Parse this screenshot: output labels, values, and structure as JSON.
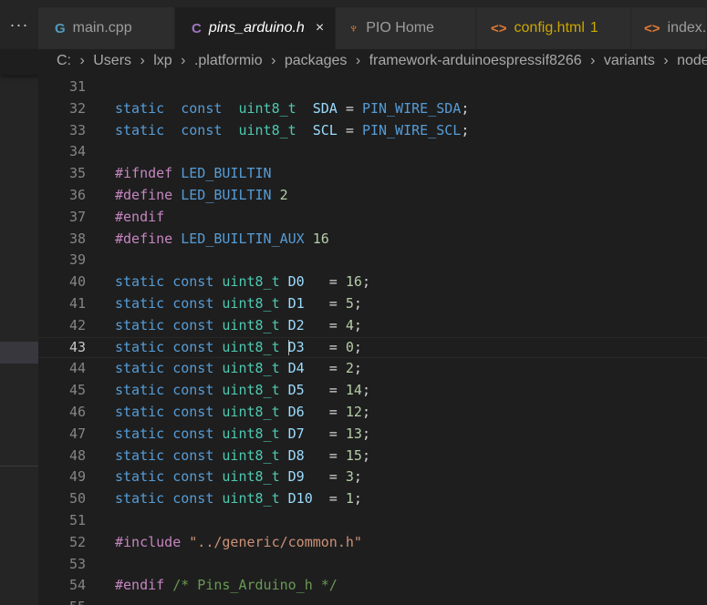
{
  "tabs": [
    {
      "label": "main.cpp",
      "icon": "c-plus-plus-file-icon",
      "glyph": "G",
      "active": false
    },
    {
      "label": "pins_arduino.h",
      "icon": "c-header-file-icon",
      "glyph": "C",
      "active": true,
      "close": "×"
    },
    {
      "label": "PIO Home",
      "icon": "platformio-ant-icon",
      "glyph": "♆",
      "active": false
    },
    {
      "label": "config.html",
      "icon": "html-file-icon",
      "glyph": "<>",
      "badge": "1",
      "active": false
    },
    {
      "label": "index.h",
      "icon": "html-file-icon",
      "glyph": "<>",
      "active": false
    }
  ],
  "more_tabs": "···",
  "breadcrumb": [
    "C:",
    "Users",
    "lxp",
    ".platformio",
    "packages",
    "framework-arduinoespressif8266",
    "variants",
    "nodemcu"
  ],
  "breadcrumb_sep": "›",
  "editor": {
    "current_line": 43,
    "lines": [
      {
        "n": "31",
        "tokens": []
      },
      {
        "n": "32",
        "tokens": [
          [
            "kw",
            "static"
          ],
          [
            "",
            "  "
          ],
          [
            "kw",
            "const"
          ],
          [
            "",
            "  "
          ],
          [
            "ty",
            "uint8_t"
          ],
          [
            "",
            "  "
          ],
          [
            "var",
            "SDA"
          ],
          [
            "",
            " = "
          ],
          [
            "mac",
            "PIN_WIRE_SDA"
          ],
          [
            "",
            ";"
          ]
        ]
      },
      {
        "n": "33",
        "tokens": [
          [
            "kw",
            "static"
          ],
          [
            "",
            "  "
          ],
          [
            "kw",
            "const"
          ],
          [
            "",
            "  "
          ],
          [
            "ty",
            "uint8_t"
          ],
          [
            "",
            "  "
          ],
          [
            "var",
            "SCL"
          ],
          [
            "",
            " = "
          ],
          [
            "mac",
            "PIN_WIRE_SCL"
          ],
          [
            "",
            ";"
          ]
        ]
      },
      {
        "n": "34",
        "tokens": []
      },
      {
        "n": "35",
        "tokens": [
          [
            "pp",
            "#ifndef"
          ],
          [
            "",
            " "
          ],
          [
            "mac",
            "LED_BUILTIN"
          ]
        ]
      },
      {
        "n": "36",
        "tokens": [
          [
            "pp",
            "#define"
          ],
          [
            "",
            " "
          ],
          [
            "mac",
            "LED_BUILTIN"
          ],
          [
            "",
            " "
          ],
          [
            "num",
            "2"
          ]
        ]
      },
      {
        "n": "37",
        "tokens": [
          [
            "pp",
            "#endif"
          ]
        ]
      },
      {
        "n": "38",
        "tokens": [
          [
            "pp",
            "#define"
          ],
          [
            "",
            " "
          ],
          [
            "mac",
            "LED_BUILTIN_AUX"
          ],
          [
            "",
            " "
          ],
          [
            "num",
            "16"
          ]
        ]
      },
      {
        "n": "39",
        "tokens": []
      },
      {
        "n": "40",
        "tokens": [
          [
            "kw",
            "static"
          ],
          [
            "",
            " "
          ],
          [
            "kw",
            "const"
          ],
          [
            "",
            " "
          ],
          [
            "ty",
            "uint8_t"
          ],
          [
            "",
            " "
          ],
          [
            "var",
            "D0"
          ],
          [
            "",
            "   = "
          ],
          [
            "num",
            "16"
          ],
          [
            "",
            ";"
          ]
        ]
      },
      {
        "n": "41",
        "tokens": [
          [
            "kw",
            "static"
          ],
          [
            "",
            " "
          ],
          [
            "kw",
            "const"
          ],
          [
            "",
            " "
          ],
          [
            "ty",
            "uint8_t"
          ],
          [
            "",
            " "
          ],
          [
            "var",
            "D1"
          ],
          [
            "",
            "   = "
          ],
          [
            "num",
            "5"
          ],
          [
            "",
            ";"
          ]
        ]
      },
      {
        "n": "42",
        "tokens": [
          [
            "kw",
            "static"
          ],
          [
            "",
            " "
          ],
          [
            "kw",
            "const"
          ],
          [
            "",
            " "
          ],
          [
            "ty",
            "uint8_t"
          ],
          [
            "",
            " "
          ],
          [
            "var",
            "D2"
          ],
          [
            "",
            "   = "
          ],
          [
            "num",
            "4"
          ],
          [
            "",
            ";"
          ]
        ]
      },
      {
        "n": "43",
        "tokens": [
          [
            "kw",
            "static"
          ],
          [
            "",
            " "
          ],
          [
            "kw",
            "const"
          ],
          [
            "",
            " "
          ],
          [
            "ty",
            "uint8_t"
          ],
          [
            "",
            " "
          ],
          [
            "cursor",
            ""
          ],
          [
            "var",
            "D3"
          ],
          [
            "",
            "   = "
          ],
          [
            "num",
            "0"
          ],
          [
            "",
            ";"
          ]
        ]
      },
      {
        "n": "44",
        "tokens": [
          [
            "kw",
            "static"
          ],
          [
            "",
            " "
          ],
          [
            "kw",
            "const"
          ],
          [
            "",
            " "
          ],
          [
            "ty",
            "uint8_t"
          ],
          [
            "",
            " "
          ],
          [
            "var",
            "D4"
          ],
          [
            "",
            "   = "
          ],
          [
            "num",
            "2"
          ],
          [
            "",
            ";"
          ]
        ]
      },
      {
        "n": "45",
        "tokens": [
          [
            "kw",
            "static"
          ],
          [
            "",
            " "
          ],
          [
            "kw",
            "const"
          ],
          [
            "",
            " "
          ],
          [
            "ty",
            "uint8_t"
          ],
          [
            "",
            " "
          ],
          [
            "var",
            "D5"
          ],
          [
            "",
            "   = "
          ],
          [
            "num",
            "14"
          ],
          [
            "",
            ";"
          ]
        ]
      },
      {
        "n": "46",
        "tokens": [
          [
            "kw",
            "static"
          ],
          [
            "",
            " "
          ],
          [
            "kw",
            "const"
          ],
          [
            "",
            " "
          ],
          [
            "ty",
            "uint8_t"
          ],
          [
            "",
            " "
          ],
          [
            "var",
            "D6"
          ],
          [
            "",
            "   = "
          ],
          [
            "num",
            "12"
          ],
          [
            "",
            ";"
          ]
        ]
      },
      {
        "n": "47",
        "tokens": [
          [
            "kw",
            "static"
          ],
          [
            "",
            " "
          ],
          [
            "kw",
            "const"
          ],
          [
            "",
            " "
          ],
          [
            "ty",
            "uint8_t"
          ],
          [
            "",
            " "
          ],
          [
            "var",
            "D7"
          ],
          [
            "",
            "   = "
          ],
          [
            "num",
            "13"
          ],
          [
            "",
            ";"
          ]
        ]
      },
      {
        "n": "48",
        "tokens": [
          [
            "kw",
            "static"
          ],
          [
            "",
            " "
          ],
          [
            "kw",
            "const"
          ],
          [
            "",
            " "
          ],
          [
            "ty",
            "uint8_t"
          ],
          [
            "",
            " "
          ],
          [
            "var",
            "D8"
          ],
          [
            "",
            "   = "
          ],
          [
            "num",
            "15"
          ],
          [
            "",
            ";"
          ]
        ]
      },
      {
        "n": "49",
        "tokens": [
          [
            "kw",
            "static"
          ],
          [
            "",
            " "
          ],
          [
            "kw",
            "const"
          ],
          [
            "",
            " "
          ],
          [
            "ty",
            "uint8_t"
          ],
          [
            "",
            " "
          ],
          [
            "var",
            "D9"
          ],
          [
            "",
            "   = "
          ],
          [
            "num",
            "3"
          ],
          [
            "",
            ";"
          ]
        ]
      },
      {
        "n": "50",
        "tokens": [
          [
            "kw",
            "static"
          ],
          [
            "",
            " "
          ],
          [
            "kw",
            "const"
          ],
          [
            "",
            " "
          ],
          [
            "ty",
            "uint8_t"
          ],
          [
            "",
            " "
          ],
          [
            "var",
            "D10"
          ],
          [
            "",
            "  = "
          ],
          [
            "num",
            "1"
          ],
          [
            "",
            ";"
          ]
        ]
      },
      {
        "n": "51",
        "tokens": []
      },
      {
        "n": "52",
        "tokens": [
          [
            "pp",
            "#include"
          ],
          [
            "",
            " "
          ],
          [
            "str",
            "\"../generic/common.h\""
          ]
        ]
      },
      {
        "n": "53",
        "tokens": []
      },
      {
        "n": "54",
        "tokens": [
          [
            "pp",
            "#endif"
          ],
          [
            "",
            " "
          ],
          [
            "cm",
            "/* Pins_Arduino_h */"
          ]
        ]
      },
      {
        "n": "55",
        "tokens": []
      }
    ]
  }
}
